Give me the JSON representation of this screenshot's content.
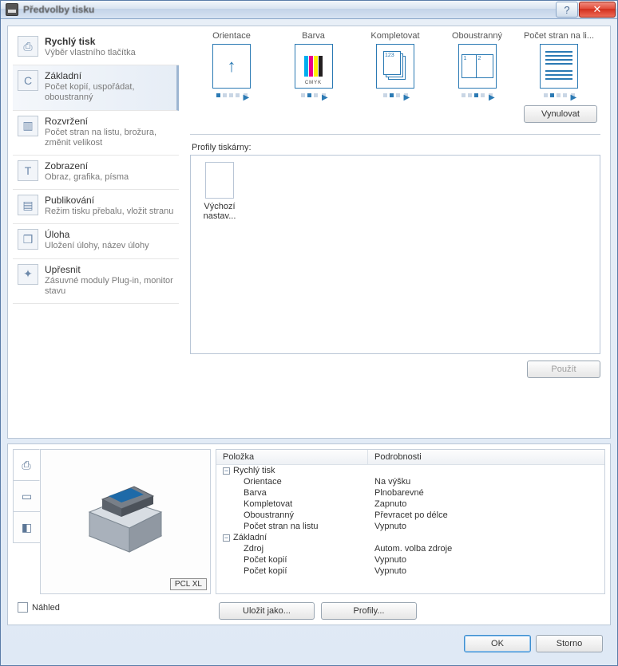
{
  "window": {
    "title": "Předvolby tisku"
  },
  "titlebar": {
    "help_glyph": "?",
    "close_glyph": "✕"
  },
  "sidebar": {
    "items": [
      {
        "title": "Rychlý tisk",
        "desc": "Výběr vlastního tlačítka",
        "icon": "⎙"
      },
      {
        "title": "Základní",
        "desc": "Počet kopií, uspořádat, oboustranný",
        "icon": "C"
      },
      {
        "title": "Rozvržení",
        "desc": "Počet stran na listu, brožura, změnit velikost",
        "icon": "▥"
      },
      {
        "title": "Zobrazení",
        "desc": "Obraz, grafika, písma",
        "icon": "T"
      },
      {
        "title": "Publikování",
        "desc": "Režim tisku přebalu, vložit stranu",
        "icon": "▤"
      },
      {
        "title": "Úloha",
        "desc": "Uložení úlohy, název úlohy",
        "icon": "❒"
      },
      {
        "title": "Upřesnit",
        "desc": "Zásuvné moduly Plug-in, monitor stavu",
        "icon": "✦"
      }
    ]
  },
  "quickprint": {
    "items": [
      {
        "label": "Orientace",
        "kind": "orient"
      },
      {
        "label": "Barva",
        "kind": "color"
      },
      {
        "label": "Kompletovat",
        "kind": "collate"
      },
      {
        "label": "Oboustranný",
        "kind": "duplex"
      },
      {
        "label": "Počet stran na li...",
        "kind": "pages"
      }
    ],
    "reset_label": "Vynulovat"
  },
  "profiles": {
    "section_label": "Profily tiskárny:",
    "default_item": "Výchozí nastav...",
    "apply_label": "Použít"
  },
  "details": {
    "col1": "Položka",
    "col2": "Podrobnosti",
    "groups": [
      {
        "name": "Rychlý tisk",
        "rows": [
          {
            "k": "Orientace",
            "v": "Na výšku"
          },
          {
            "k": "Barva",
            "v": "Plnobarevné"
          },
          {
            "k": "Kompletovat",
            "v": "Zapnuto"
          },
          {
            "k": "Oboustranný",
            "v": "Převracet po délce"
          },
          {
            "k": "Počet stran na listu",
            "v": "Vypnuto"
          }
        ]
      },
      {
        "name": "Základní",
        "rows": [
          {
            "k": "Zdroj",
            "v": "Autom. volba zdroje"
          },
          {
            "k": "Počet kopií",
            "v": "Vypnuto"
          },
          {
            "k": "Počet kopií",
            "v": "Vypnuto"
          }
        ]
      }
    ]
  },
  "preview": {
    "checkbox_label": "Náhled",
    "badge": "PCL XL"
  },
  "buttons": {
    "save_as": "Uložit jako...",
    "profiles": "Profily...",
    "ok": "OK",
    "cancel": "Storno"
  },
  "colors": {
    "cmyk": [
      "#00aeef",
      "#ec008c",
      "#fff200",
      "#231f20"
    ]
  }
}
